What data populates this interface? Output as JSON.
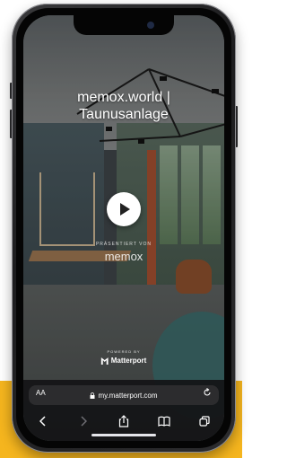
{
  "tour": {
    "title_line1": "memox.world |",
    "title_line2": "Taunusanlage",
    "presented_by": "PRÄSENTIERT VON",
    "presenter": "memox",
    "powered_by": "POWERED BY",
    "platform": "Matterport"
  },
  "browser": {
    "text_size_label": "AA",
    "url": "my.matterport.com"
  },
  "colors": {
    "accent_band": "#f5b51e",
    "phone_frame": "#1c1c1e",
    "toolbar_bg": "#141416"
  },
  "icons": {
    "play": "play-icon",
    "lock": "lock-icon",
    "reload": "reload-icon",
    "back": "chevron-left-icon",
    "forward": "chevron-right-icon",
    "share": "share-icon",
    "bookmarks": "book-icon",
    "tabs": "tabs-icon"
  }
}
